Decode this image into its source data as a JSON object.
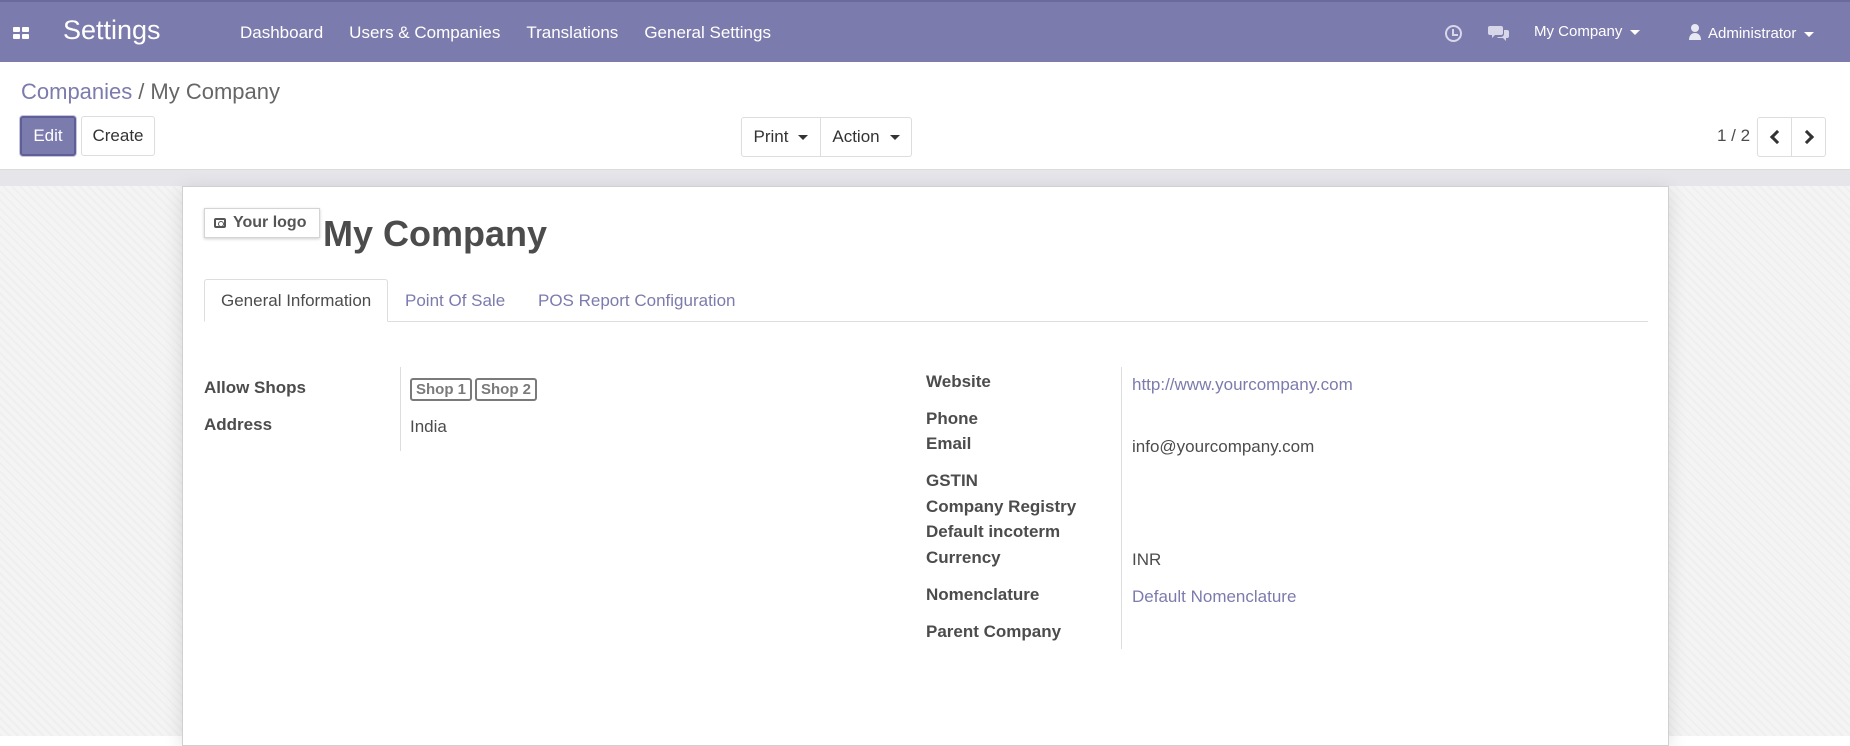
{
  "navbar": {
    "app_title": "Settings",
    "menu": [
      "Dashboard",
      "Users & Companies",
      "Translations",
      "General Settings"
    ],
    "company_switcher": "My Company",
    "user": "Administrator"
  },
  "breadcrumb": {
    "parent": "Companies",
    "separator": "/",
    "current": "My Company"
  },
  "buttons": {
    "edit": "Edit",
    "create": "Create",
    "print": "Print",
    "action": "Action"
  },
  "pager": {
    "value": "1 / 2"
  },
  "form": {
    "logo_label": "Your logo",
    "company_name": "My Company",
    "tabs": [
      "General Information",
      "Point Of Sale",
      "POS Report Configuration"
    ],
    "left": {
      "allow_shops_label": "Allow Shops",
      "shops": [
        "Shop 1",
        "Shop 2"
      ],
      "address_label": "Address",
      "address_value": "India"
    },
    "right": {
      "website_label": "Website",
      "website_value": "http://www.yourcompany.com",
      "phone_label": "Phone",
      "email_label": "Email",
      "email_value": "info@yourcompany.com",
      "gstin_label": "GSTIN",
      "registry_label": "Company Registry",
      "incoterm_label": "Default incoterm",
      "currency_label": "Currency",
      "currency_value": "INR",
      "nomenclature_label": "Nomenclature",
      "nomenclature_value": "Default Nomenclature",
      "parent_label": "Parent Company"
    }
  },
  "colors": {
    "brand": "#7c7bad",
    "text": "#4c4c4c"
  }
}
